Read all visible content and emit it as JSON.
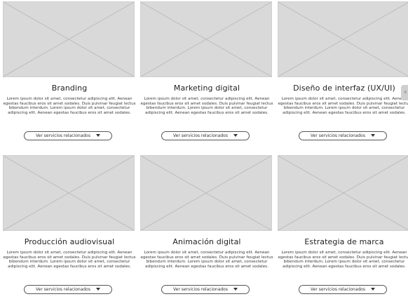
{
  "cards": [
    {
      "title": "Branding",
      "desc": "Lorem ipsum dolor sit amet, consectetur adipiscing elit. Aenean egestas faucibus eros sit amet sodales. Duis pulvinar feugiat lectus bibendum interdum. Lorem ipsum dolor sit amet, consectetur adipiscing elit. Aenean egestas faucibus eros sit amet sodales.",
      "button": "Ver servicios relacionados"
    },
    {
      "title": "Marketing digital",
      "desc": "Lorem ipsum dolor sit amet, consectetur adipiscing elit. Aenean egestas faucibus eros sit amet sodales. Duis pulvinar feugiat lectus bibendum interdum. Lorem ipsum dolor sit amet, consectetur adipiscing elit. Aenean egestas faucibus eros sit amet sodales.",
      "button": "Ver servicios relacionados"
    },
    {
      "title": "Diseño de interfaz (UX/UI)",
      "desc": "Lorem ipsum dolor sit amet, consectetur adipiscing elit. Aenean egestas faucibus eros sit amet sodales. Duis pulvinar feugiat lectus bibendum interdum. Lorem ipsum dolor sit amet, consectetur adipiscing elit. Aenean egestas faucibus eros sit amet sodales.",
      "button": "Ver servicios relacionados"
    },
    {
      "title": "Producción audiovisual",
      "desc": "Lorem ipsum dolor sit amet, consectetur adipiscing elit. Aenean egestas faucibus eros sit amet sodales. Duis pulvinar feugiat lectus bibendum interdum. Lorem ipsum dolor sit amet, consectetur adipiscing elit. Aenean egestas faucibus eros sit amet sodales.",
      "button": "Ver servicios relacionados"
    },
    {
      "title": "Animación digital",
      "desc": "Lorem ipsum dolor sit amet, consectetur adipiscing elit. Aenean egestas faucibus eros sit amet sodales. Duis pulvinar feugiat lectus bibendum interdum. Lorem ipsum dolor sit amet, consectetur adipiscing elit. Aenean egestas faucibus eros sit amet sodales.",
      "button": "Ver servicios relacionados"
    },
    {
      "title": "Estrategia de marca",
      "desc": "Lorem ipsum dolor sit amet, consectetur adipiscing elit. Aenean egestas faucibus eros sit amet sodales. Duis pulvinar feugiat lectus bibendum interdum. Lorem ipsum dolor sit amet, consectetur adipiscing elit. Aenean egestas faucibus eros sit amet sodales.",
      "button": "Ver servicios relacionados"
    }
  ],
  "side_tab": {
    "label": "c"
  },
  "icons": {
    "placeholder": "image-placeholder-icon",
    "caret": "caret-down-icon"
  },
  "colors": {
    "placeholder_fill": "#d9d9d9",
    "placeholder_lines": "#bdbdbd",
    "button_border": "#555555"
  }
}
